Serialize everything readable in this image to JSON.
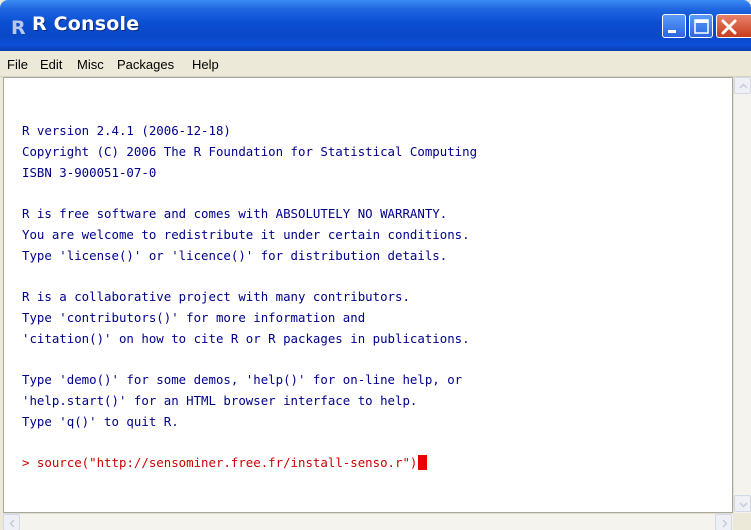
{
  "window": {
    "title": "R Console",
    "app_icon": "r-logo-icon",
    "controls": [
      "minimize-icon",
      "maximize-icon",
      "close-icon"
    ],
    "accent": "#0a4ed1"
  },
  "menu": {
    "items": [
      "File",
      "Edit",
      "Misc",
      "Packages",
      "Help"
    ]
  },
  "console": {
    "output_color": "#00008b",
    "command_color": "#cc0000",
    "lines": [
      "R version 2.4.1 (2006-12-18)",
      "Copyright (C) 2006 The R Foundation for Statistical Computing",
      "ISBN 3-900051-07-0",
      "R is free software and comes with ABSOLUTELY NO WARRANTY.",
      "You are welcome to redistribute it under certain conditions.",
      "Type 'license()' or 'licence()' for distribution details.",
      "R is a collaborative project with many contributors.",
      "Type 'contributors()' for more information and",
      "'citation()' on how to cite R or R packages in publications.",
      "Type 'demo()' for some demos, 'help()' for on-line help, or",
      "'help.start()' for an HTML browser interface to help.",
      "Type 'q()' to quit R."
    ],
    "prompt": "> ",
    "command": "source(\"http://sensominer.free.fr/install-senso.r\")"
  },
  "scrollbars": {
    "up": "scroll-up-icon",
    "down": "scroll-down-icon",
    "left": "scroll-left-icon",
    "right": "scroll-right-icon"
  }
}
